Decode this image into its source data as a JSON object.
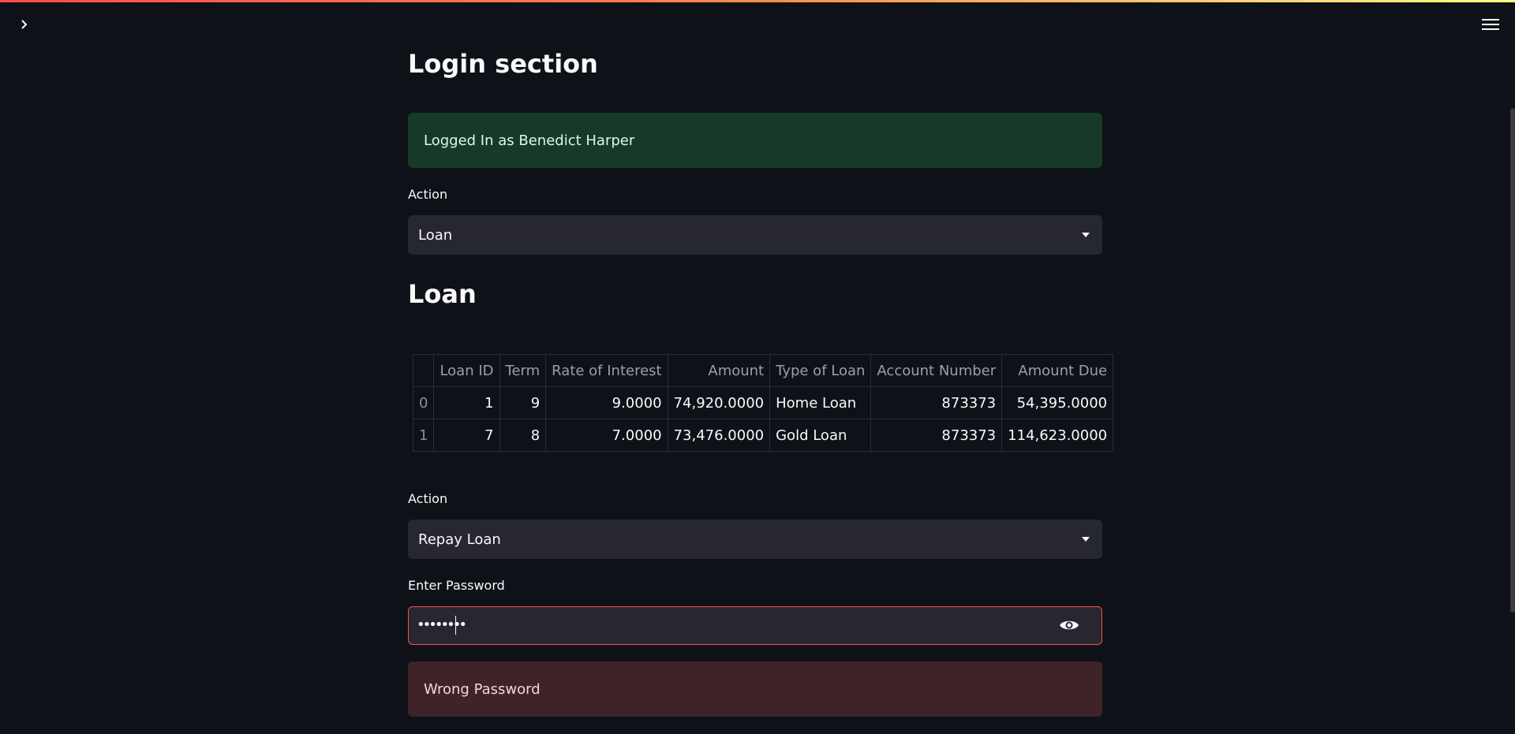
{
  "theme": {
    "accent": "#ff4b4b",
    "background": "#0e1117",
    "success_bg": "#173928",
    "error_bg": "#3e2328"
  },
  "page": {
    "title": "Login section",
    "login_status": "Logged In as Benedict Harper"
  },
  "action1": {
    "label": "Action",
    "value": "Loan"
  },
  "loan": {
    "heading": "Loan",
    "columns": [
      "",
      "Loan ID",
      "Term",
      "Rate of Interest",
      "Amount",
      "Type of Loan",
      "Account Number",
      "Amount Due"
    ],
    "rows": [
      [
        "0",
        "1",
        "9",
        "9.0000",
        "74,920.0000",
        "Home Loan",
        "873373",
        "54,395.0000"
      ],
      [
        "1",
        "7",
        "8",
        "7.0000",
        "73,476.0000",
        "Gold Loan",
        "873373",
        "114,623.0000"
      ]
    ]
  },
  "action2": {
    "label": "Action",
    "value": "Repay Loan"
  },
  "password": {
    "label": "Enter Password",
    "value": "••••••••"
  },
  "error": {
    "message": "Wrong Password"
  },
  "icons": {
    "sidebar_toggle": "chevron-right-icon",
    "menu": "hamburger-menu-icon",
    "dropdown": "caret-down-icon",
    "visibility": "eye-icon"
  }
}
